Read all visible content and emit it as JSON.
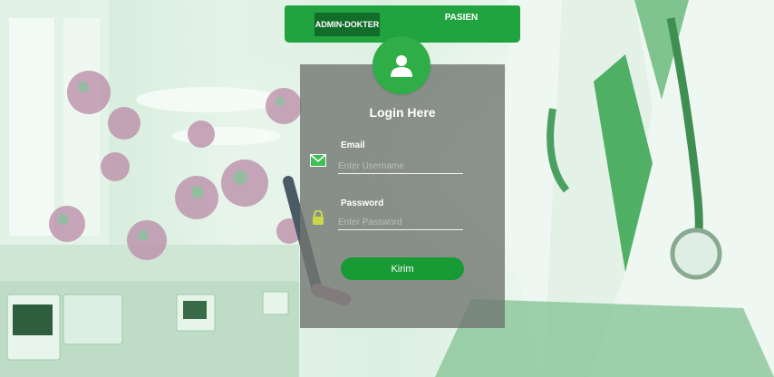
{
  "nav": {
    "admin_label": "ADMIN-DOKTER",
    "pasien_label": "PASIEN"
  },
  "login": {
    "title": "Login Here",
    "email_label": "Email",
    "email_placeholder": "Enter Username",
    "password_label": "Password",
    "password_placeholder": "Enter Password",
    "submit_label": "Kirim"
  },
  "colors": {
    "primary_green": "#21a33f",
    "active_tab": "#126c2a",
    "button": "#189b34",
    "panel": "rgba(112,118,112,0.80)"
  },
  "icons": [
    "user-icon",
    "envelope-icon",
    "lock-icon"
  ]
}
